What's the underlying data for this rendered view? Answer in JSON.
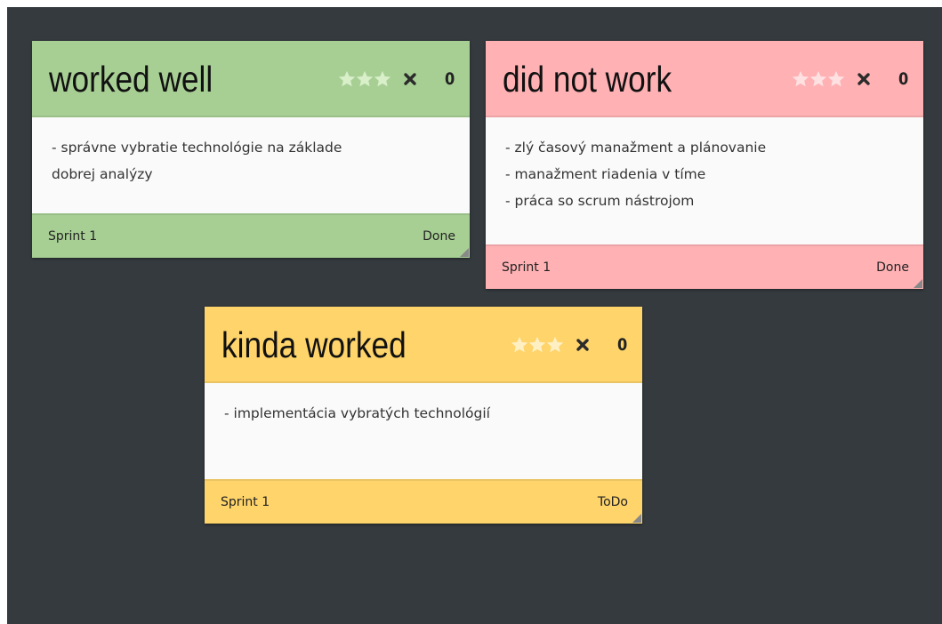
{
  "colors": {
    "board": "#343a3e",
    "green": "#a7cf94",
    "red": "#ffb1b4",
    "yellow": "#fed46b",
    "body": "#fafafa"
  },
  "cards": [
    {
      "title": "worked well",
      "vote_count": "0",
      "body_lines": [
        " - správne vybratie technológie na základe",
        "dobrej analýzy"
      ],
      "sprint": "Sprint 1",
      "status": "Done",
      "color": "#a7cf94",
      "star_color": "#d8efc9"
    },
    {
      "title": "did not work",
      "vote_count": "0",
      "body_lines": [
        "- zlý časový manažment a plánovanie",
        "- manažment riadenia v tíme",
        "- práca so scrum nástrojom"
      ],
      "sprint": "Sprint 1",
      "status": "Done",
      "color": "#ffb1b4",
      "star_color": "#ffe1e2"
    },
    {
      "title": "kinda worked",
      "vote_count": "0",
      "body_lines": [
        "- implementácia vybratých technológií"
      ],
      "sprint": "Sprint 1",
      "status": "ToDo",
      "color": "#fed46b",
      "star_color": "#fff0c4"
    }
  ]
}
